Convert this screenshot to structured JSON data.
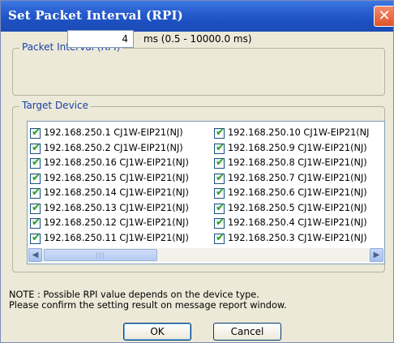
{
  "window": {
    "title": "Set Packet Interval (RPI)"
  },
  "rpi": {
    "group_label": "Packet Interval (RPI)",
    "value": "4",
    "unit_range": "ms (0.5 - 10000.0 ms)"
  },
  "devices": {
    "group_label": "Target Device",
    "left": [
      {
        "label": "192.168.250.1 CJ1W-EIP21(NJ)",
        "checked": true
      },
      {
        "label": "192.168.250.2 CJ1W-EIP21(NJ)",
        "checked": true
      },
      {
        "label": "192.168.250.16 CJ1W-EIP21(NJ)",
        "checked": true
      },
      {
        "label": "192.168.250.15 CJ1W-EIP21(NJ)",
        "checked": true
      },
      {
        "label": "192.168.250.14 CJ1W-EIP21(NJ)",
        "checked": true
      },
      {
        "label": "192.168.250.13 CJ1W-EIP21(NJ)",
        "checked": true
      },
      {
        "label": "192.168.250.12 CJ1W-EIP21(NJ)",
        "checked": true
      },
      {
        "label": "192.168.250.11 CJ1W-EIP21(NJ)",
        "checked": true
      }
    ],
    "right": [
      {
        "label": "192.168.250.10 CJ1W-EIP21(NJ",
        "checked": true
      },
      {
        "label": "192.168.250.9 CJ1W-EIP21(NJ)",
        "checked": true
      },
      {
        "label": "192.168.250.8 CJ1W-EIP21(NJ)",
        "checked": true
      },
      {
        "label": "192.168.250.7 CJ1W-EIP21(NJ)",
        "checked": true
      },
      {
        "label": "192.168.250.6 CJ1W-EIP21(NJ)",
        "checked": true
      },
      {
        "label": "192.168.250.5 CJ1W-EIP21(NJ)",
        "checked": true
      },
      {
        "label": "192.168.250.4 CJ1W-EIP21(NJ)",
        "checked": true
      },
      {
        "label": "192.168.250.3 CJ1W-EIP21(NJ)",
        "checked": true
      }
    ]
  },
  "note": {
    "line1": "NOTE : Possible RPI value depends on the device type.",
    "line2": "Please confirm the setting result on message report window."
  },
  "buttons": {
    "ok": "OK",
    "cancel": "Cancel"
  },
  "icons": {
    "close": "close-icon",
    "checkbox_check": "checkmark-icon",
    "scroll_left": "arrow-left-icon",
    "scroll_right": "arrow-right-icon"
  },
  "colors": {
    "titlebar": "#2a5fd0",
    "dialog_bg": "#ece9d8",
    "group_label": "#1c3fa8",
    "check": "#21a121"
  }
}
